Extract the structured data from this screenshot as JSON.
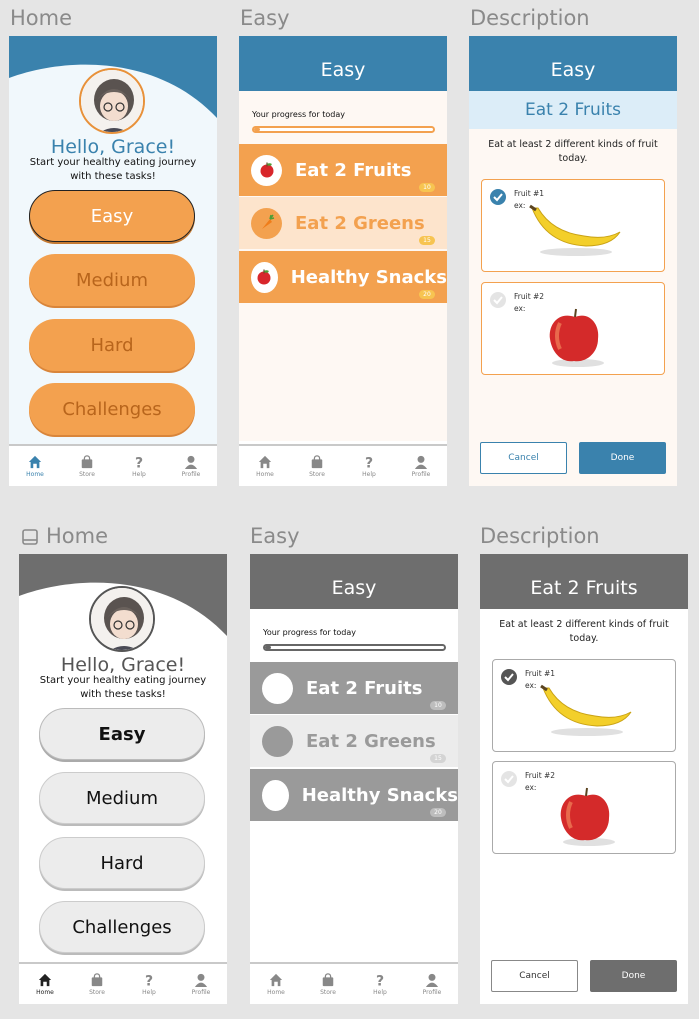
{
  "labels": {
    "home": "Home",
    "easy": "Easy",
    "description": "Description"
  },
  "colors": {
    "primary": "#3a82ad",
    "orange": "#f3a14f",
    "orange_text": "#b8651c",
    "peach": "#fde4cc",
    "light_blue": "#dcedf8",
    "gray_header": "#6e6e6e",
    "gray_task": "#9a9a9a",
    "gray_light": "#ececec"
  },
  "home": {
    "greeting": "Hello, Grace!",
    "subtitle_line1": "Start your healthy eating journey",
    "subtitle_line2": "with these tasks!",
    "buttons": [
      "Easy",
      "Medium",
      "Hard",
      "Challenges"
    ]
  },
  "nav": {
    "items": [
      {
        "label": "Home",
        "icon": "home-icon"
      },
      {
        "label": "Store",
        "icon": "bag-icon"
      },
      {
        "label": "Help",
        "icon": "question-icon"
      },
      {
        "label": "Profile",
        "icon": "person-icon"
      }
    ]
  },
  "easy": {
    "title": "Easy",
    "progress_label": "Your progress for today",
    "progress": 0.04,
    "tasks": [
      {
        "title": "Eat 2 Fruits",
        "points": "10",
        "icon": "apple-icon"
      },
      {
        "title": "Eat 2 Greens",
        "points": "15",
        "icon": "carrot-icon"
      },
      {
        "title": "Healthy Snacks",
        "points": "20",
        "icon": "apple-icon"
      }
    ]
  },
  "description": {
    "title": "Easy",
    "task_title": "Eat 2 Fruits",
    "text_line1": "Eat at least 2 different kinds of fruit",
    "text_line2": "today.",
    "cards": [
      {
        "label": "Fruit #1",
        "ex": "ex:",
        "fruit": "banana",
        "checked": true
      },
      {
        "label": "Fruit #2",
        "ex": "ex:",
        "fruit": "apple",
        "checked": false
      }
    ],
    "cancel": "Cancel",
    "done": "Done"
  }
}
